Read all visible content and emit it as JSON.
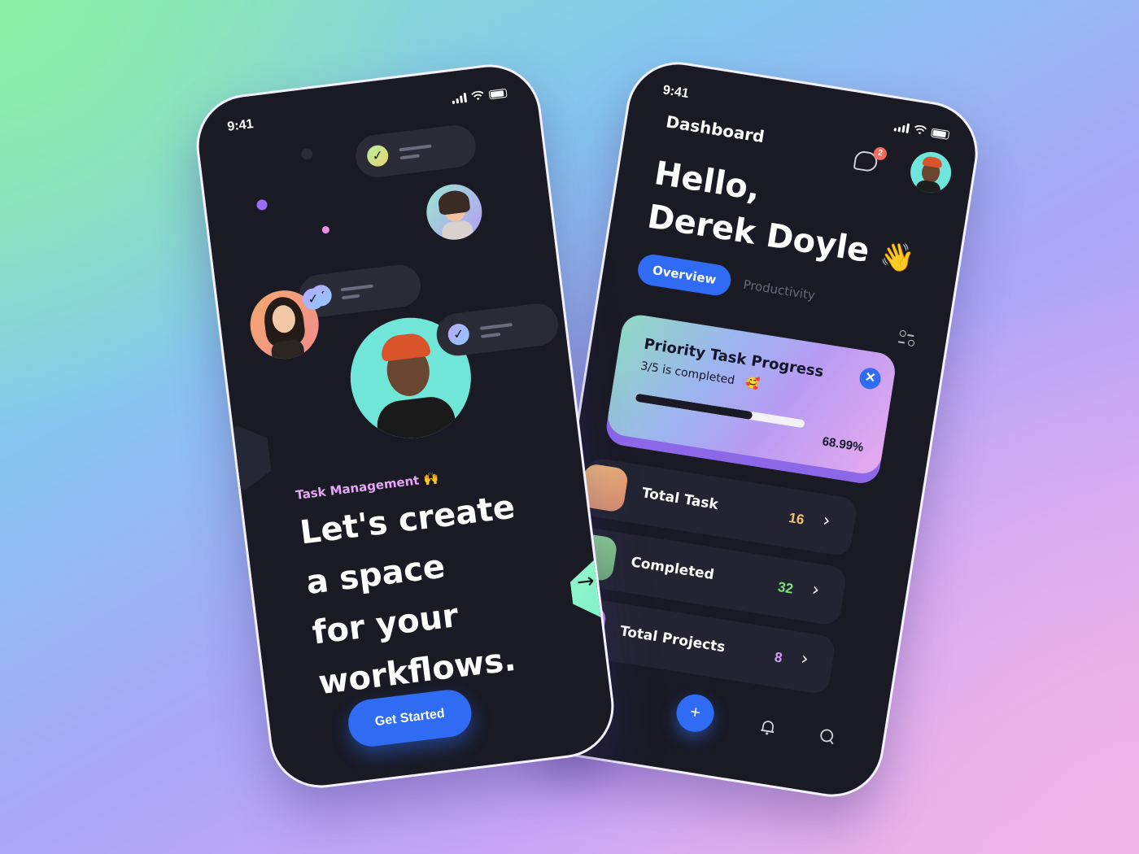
{
  "onboarding": {
    "status_time": "9:41",
    "tagline": "Task Management",
    "tagline_emoji": "🙌",
    "headline_lines": [
      "Let's create",
      "a space",
      "for your",
      "workflows."
    ],
    "cta_label": "Get Started",
    "next_arrow": "→"
  },
  "dashboard": {
    "status_time": "9:41",
    "title": "Dashboard",
    "notification_count": "2",
    "greeting_line1": "Hello,",
    "greeting_line2": "Derek Doyle",
    "wave_emoji": "👋",
    "tabs": [
      {
        "label": "Overview",
        "active": true
      },
      {
        "label": "Productivity",
        "active": false
      }
    ],
    "priority_card": {
      "title": "Priority Task Progress",
      "subtitle": "3/5 is completed",
      "subtitle_emoji": "🥰",
      "progress": 0.6899,
      "percent_label": "68.99%",
      "close_glyph": "✕"
    },
    "stats": [
      {
        "label": "Total Task",
        "value": "16",
        "color": "#f3c26b",
        "thumb": "#e9a77a"
      },
      {
        "label": "Completed",
        "value": "32",
        "color": "#7fe07b",
        "thumb": "#7cc28a"
      },
      {
        "label": "Total Projects",
        "value": "8",
        "color": "#d59cf6",
        "thumb": "#c78ff0"
      }
    ],
    "chevron": "›",
    "fab_glyph": "+"
  },
  "colors": {
    "accent": "#2f6bf3",
    "phone_bg": "#191a24",
    "mint": "#8ff3cf"
  }
}
